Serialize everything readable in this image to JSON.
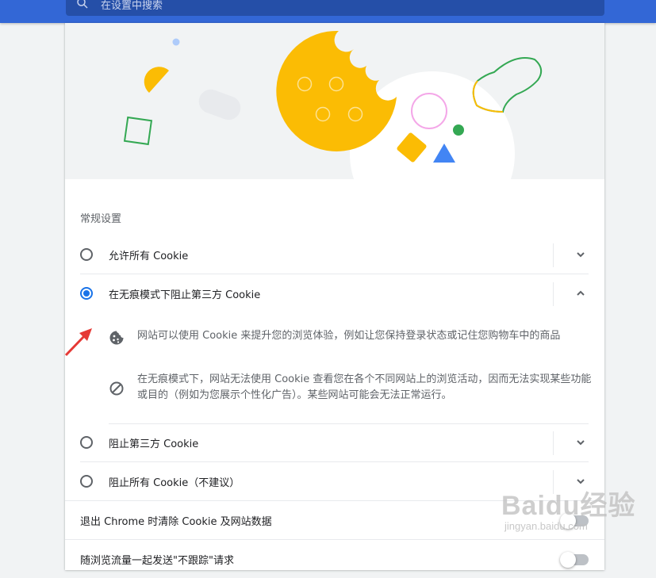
{
  "search": {
    "placeholder": "在设置中搜索"
  },
  "section": {
    "title": "常规设置"
  },
  "options": [
    {
      "label": "允许所有 Cookie",
      "checked": false,
      "expanded": false
    },
    {
      "label": "在无痕模式下阻止第三方 Cookie",
      "checked": true,
      "expanded": true
    },
    {
      "label": "阻止第三方 Cookie",
      "checked": false,
      "expanded": false
    },
    {
      "label": "阻止所有 Cookie（不建议）",
      "checked": false,
      "expanded": false
    }
  ],
  "details": [
    {
      "icon": "cookie-icon",
      "text": "网站可以使用 Cookie 来提升您的浏览体验，例如让您保持登录状态或记住您购物车中的商品"
    },
    {
      "icon": "block-icon",
      "text": "在无痕模式下，网站无法使用 Cookie 查看您在各个不同网站上的浏览活动，因而无法实现某些功能或目的（例如为您展示个性化广告）。某些网站可能会无法正常运行。"
    }
  ],
  "toggles": [
    {
      "label": "退出 Chrome 时清除 Cookie 及网站数据",
      "on": false
    },
    {
      "label": "随浏览流量一起发送\"不跟踪\"请求",
      "on": false
    }
  ],
  "watermark": {
    "brand": "Baidu经验",
    "url": "jingyan.baidu.com"
  },
  "colors": {
    "header": "#3367d6",
    "accent": "#1a73e8",
    "cookie": "#fbbc04",
    "green": "#34a853",
    "blue": "#4285f4",
    "pink": "#f4a7e8"
  }
}
